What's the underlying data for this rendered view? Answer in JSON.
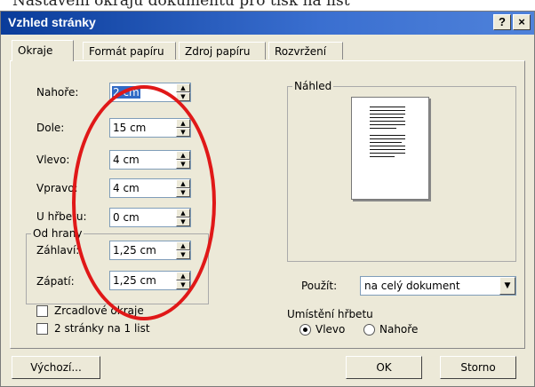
{
  "top_strip_text": "Nastavení okrajů dokumentu pro tisk na list",
  "dialog": {
    "title": "Vzhled stránky",
    "help_button": "?",
    "close_button": "×"
  },
  "tabs": [
    {
      "label": "Okraje",
      "active": true
    },
    {
      "label": "Formát papíru",
      "active": false
    },
    {
      "label": "Zdroj papíru",
      "active": false
    },
    {
      "label": "Rozvržení",
      "active": false
    }
  ],
  "margins": {
    "top": {
      "label": "Nahoře:",
      "value": "2 cm"
    },
    "bottom": {
      "label": "Dole:",
      "value": "15 cm"
    },
    "left": {
      "label": "Vlevo:",
      "value": "4 cm"
    },
    "right": {
      "label": "Vpravo:",
      "value": "4 cm"
    },
    "gutter": {
      "label": "U hřbetu:",
      "value": "0 cm"
    }
  },
  "from_edge": {
    "group_label": "Od hrany",
    "header": {
      "label": "Záhlaví:",
      "value": "1,25 cm"
    },
    "footer": {
      "label": "Zápatí:",
      "value": "1,25 cm"
    }
  },
  "checkboxes": {
    "mirror_margins": {
      "label": "Zrcadlové okraje",
      "checked": false
    },
    "two_pages": {
      "label": "2 stránky na 1 list",
      "checked": false
    }
  },
  "preview": {
    "label": "Náhled"
  },
  "apply_to": {
    "label": "Použít:",
    "value": "na celý dokument"
  },
  "gutter_position": {
    "label": "Umístění hřbetu",
    "left": {
      "label": "Vlevo",
      "selected": true
    },
    "top": {
      "label": "Nahoře",
      "selected": false
    }
  },
  "buttons": {
    "default": "Výchozí...",
    "ok": "OK",
    "cancel": "Storno"
  },
  "colors": {
    "titlebar": "#0a3c9a",
    "dialog_bg": "#ece9d8",
    "annotation_circle": "#e01818",
    "selection": "#316ac5"
  }
}
